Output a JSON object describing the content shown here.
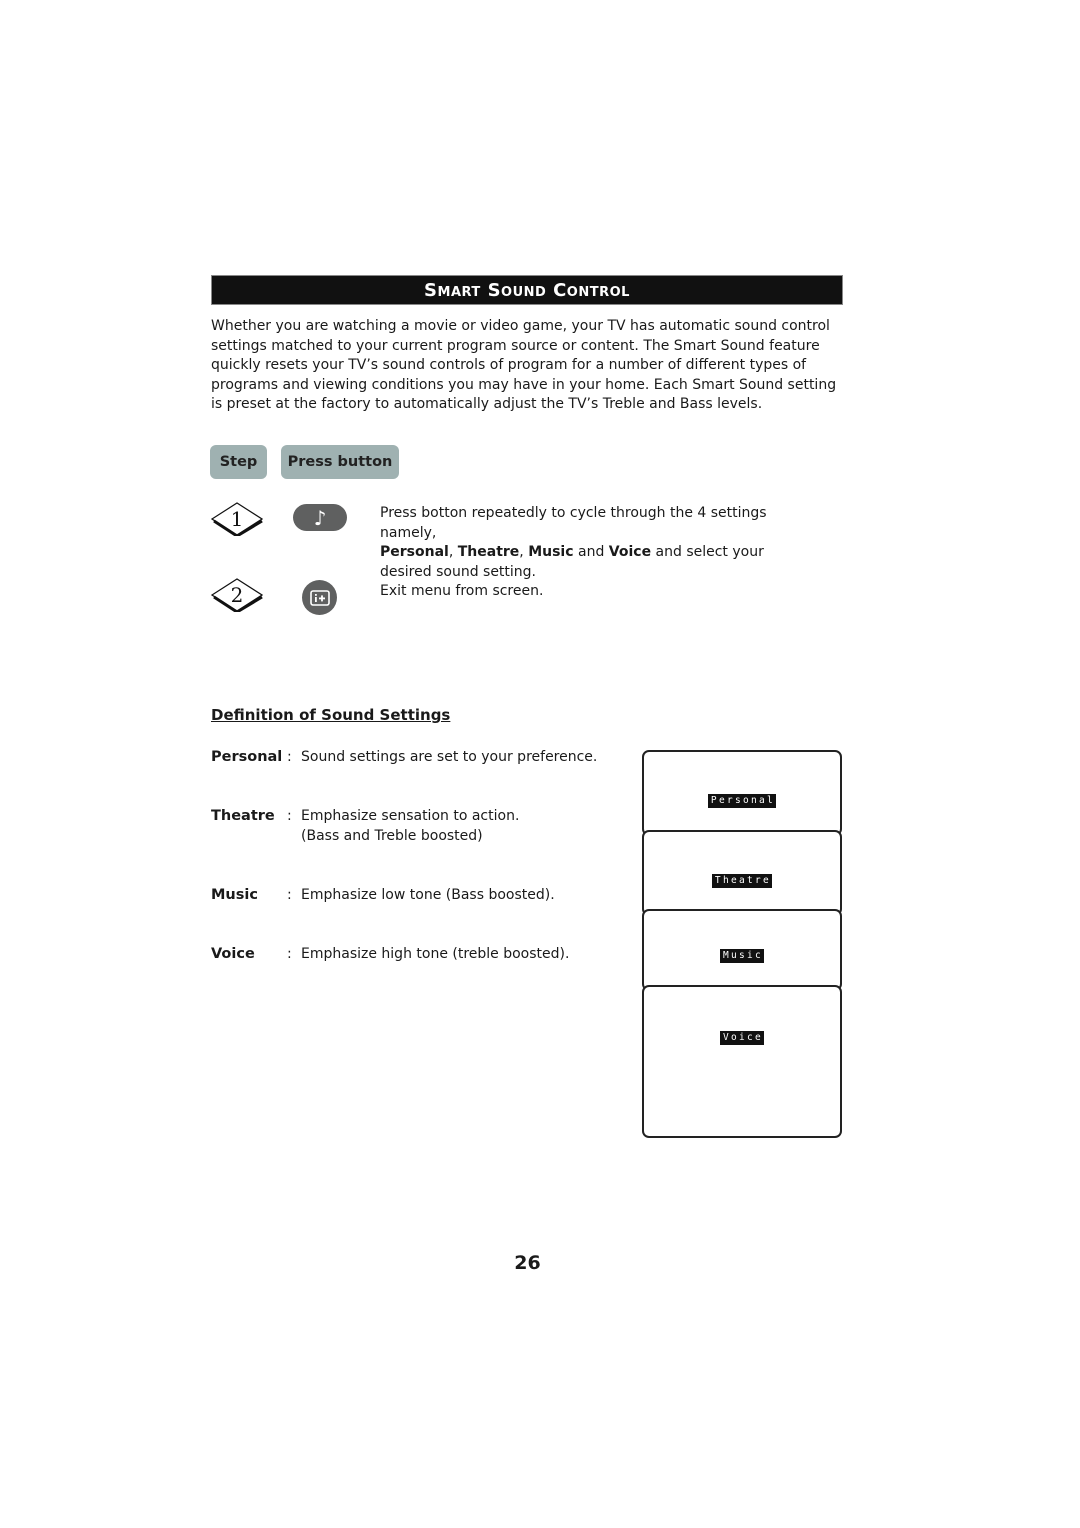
{
  "header": {
    "title": "Smart Sound Control"
  },
  "intro": "Whether you are watching a movie or video game, your TV has automatic sound control settings matched to your current program source or content. The Smart Sound feature quickly resets your TV’s sound controls of program for a number of different types of programs and viewing conditions you may have in your home. Each Smart Sound setting is preset at the factory to automatically adjust the TV’s Treble and Bass levels.",
  "table_header": {
    "step": "Step",
    "press_button": "Press button"
  },
  "steps": [
    {
      "number": "1",
      "button_icon": "music-note-icon",
      "text_prefix": "Press botton repeatedly to cycle through the 4 settings namely,",
      "settings": [
        "Personal",
        "Theatre",
        "Music",
        "Voice"
      ],
      "sep1": ", ",
      "sep2": ", ",
      "and1": " and ",
      "text_suffix": " and select your desired sound setting."
    },
    {
      "number": "2",
      "button_icon": "info-plus-icon",
      "text": "Exit menu from screen."
    }
  ],
  "definitions": {
    "heading": "Definition of Sound Settings",
    "items": [
      {
        "term": "Personal",
        "colon": ":",
        "desc": "Sound settings are set to your preference.",
        "desc2": ""
      },
      {
        "term": "Theatre",
        "colon": ":",
        "desc": "Emphasize sensation to action.",
        "desc2": "(Bass and Treble boosted)"
      },
      {
        "term": "Music",
        "colon": ":",
        "desc": "Emphasize low tone (Bass boosted).",
        "desc2": ""
      },
      {
        "term": "Voice",
        "colon": ":",
        "desc": "Emphasize high tone (treble boosted).",
        "desc2": ""
      }
    ]
  },
  "screens": [
    "Personal",
    "Theatre",
    "Music",
    "Voice"
  ],
  "page_number": "26"
}
